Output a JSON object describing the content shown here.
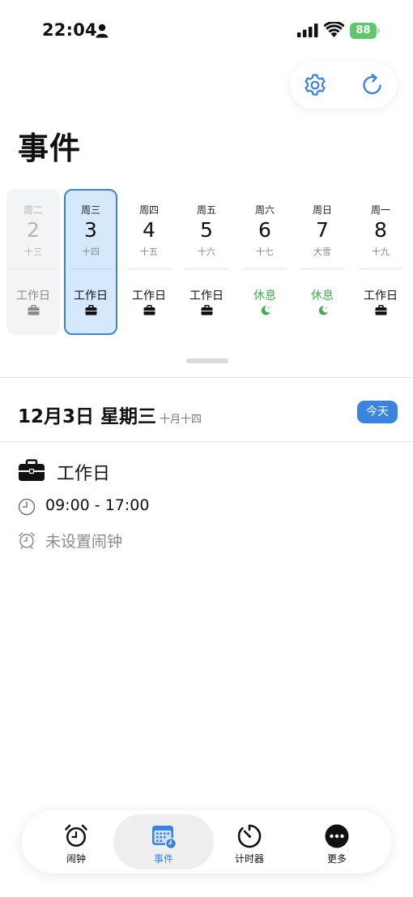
{
  "status_bar": {
    "time": "22:04",
    "battery": "88"
  },
  "page": {
    "title": "事件"
  },
  "week": [
    {
      "weekday": "周二",
      "date": "2",
      "lunar": "十三",
      "tag": "工作日",
      "kind": "work",
      "state": "past"
    },
    {
      "weekday": "周三",
      "date": "3",
      "lunar": "十四",
      "tag": "工作日",
      "kind": "work",
      "state": "selected"
    },
    {
      "weekday": "周四",
      "date": "4",
      "lunar": "十五",
      "tag": "工作日",
      "kind": "work",
      "state": "normal"
    },
    {
      "weekday": "周五",
      "date": "5",
      "lunar": "十六",
      "tag": "工作日",
      "kind": "work",
      "state": "normal"
    },
    {
      "weekday": "周六",
      "date": "6",
      "lunar": "十七",
      "tag": "休息",
      "kind": "rest",
      "state": "normal"
    },
    {
      "weekday": "周日",
      "date": "7",
      "lunar": "大雪",
      "tag": "休息",
      "kind": "rest",
      "state": "normal"
    },
    {
      "weekday": "周一",
      "date": "8",
      "lunar": "十九",
      "tag": "工作日",
      "kind": "work",
      "state": "normal"
    }
  ],
  "detail": {
    "date": "12月3日 星期三",
    "lunar": "十月十四",
    "today_badge": "今天",
    "event_title": "工作日",
    "time_range": "09:00 - 17:00",
    "alarm_text": "未设置闹钟"
  },
  "tabs": [
    {
      "label": "闹钟",
      "icon": "alarm-clock-icon",
      "active": false
    },
    {
      "label": "事件",
      "icon": "calendar-icon",
      "active": true
    },
    {
      "label": "计时器",
      "icon": "timer-icon",
      "active": false
    },
    {
      "label": "更多",
      "icon": "more-icon",
      "active": false
    }
  ],
  "colors": {
    "accent": "#3a84e0",
    "rest": "#3dae4e",
    "battery": "#5fc76a",
    "selected_bg": "#d6e8fb"
  }
}
